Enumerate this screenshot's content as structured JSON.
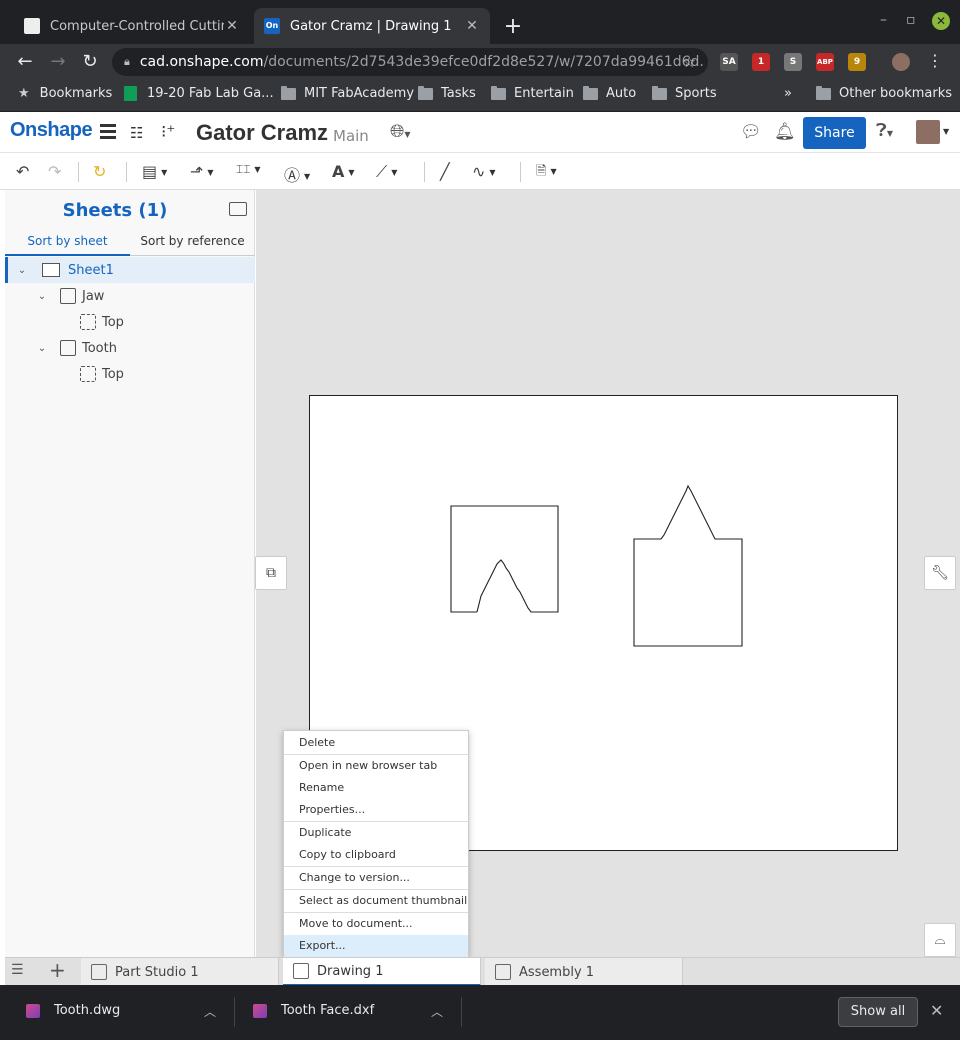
{
  "browser": {
    "tabs": [
      {
        "title": "Computer-Controlled Cutting",
        "active": false
      },
      {
        "title": "Gator Cramz | Drawing 1",
        "active": true
      }
    ],
    "new_tab": "+",
    "url_host": "cad.onshape.com",
    "url_path": "/documents/2d7543de39efce0df2d8e527/w/7207da99461d6d...",
    "extensions": [
      "SA",
      "1",
      "S",
      "ABP",
      "9"
    ],
    "bookmarks": [
      {
        "label": "Bookmarks",
        "icon": "star-icon"
      },
      {
        "label": "19-20 Fab Lab Ga...",
        "icon": "sheets-icon"
      },
      {
        "label": "MIT FabAcademy",
        "icon": "folder-icon"
      },
      {
        "label": "Tasks",
        "icon": "folder-icon"
      },
      {
        "label": "Entertain",
        "icon": "folder-icon"
      },
      {
        "label": "Auto",
        "icon": "folder-icon"
      },
      {
        "label": "Sports",
        "icon": "folder-icon"
      }
    ],
    "more_bookmarks": "»",
    "other_bookmarks": "Other bookmarks"
  },
  "app": {
    "logo": "Onshape",
    "doc_title": "Gator Cramz",
    "branch": "Main",
    "share_label": "Share",
    "brand_color": "#1565c0"
  },
  "left_panel": {
    "title": "Sheets (1)",
    "sort_tabs": [
      "Sort by sheet",
      "Sort by reference"
    ],
    "tree": [
      {
        "label": "Sheet1",
        "level": 0,
        "selected": true
      },
      {
        "label": "Jaw",
        "level": 1
      },
      {
        "label": "Top",
        "level": 2
      },
      {
        "label": "Tooth",
        "level": 1
      },
      {
        "label": "Top",
        "level": 2
      }
    ]
  },
  "context_menu": {
    "items": [
      "Delete",
      "Open in new browser tab",
      "Rename",
      "Properties...",
      "Duplicate",
      "Copy to clipboard",
      "Change to version...",
      "Select as document thumbnail",
      "Move to document...",
      "Export..."
    ],
    "highlighted": "Export..."
  },
  "bottom_tabs": [
    {
      "label": "Part Studio 1",
      "active": false
    },
    {
      "label": "Drawing 1",
      "active": true
    },
    {
      "label": "Assembly 1",
      "active": false
    }
  ],
  "downloads": {
    "items": [
      "Tooth.dwg",
      "Tooth Face.dxf"
    ],
    "show_all": "Show all"
  }
}
